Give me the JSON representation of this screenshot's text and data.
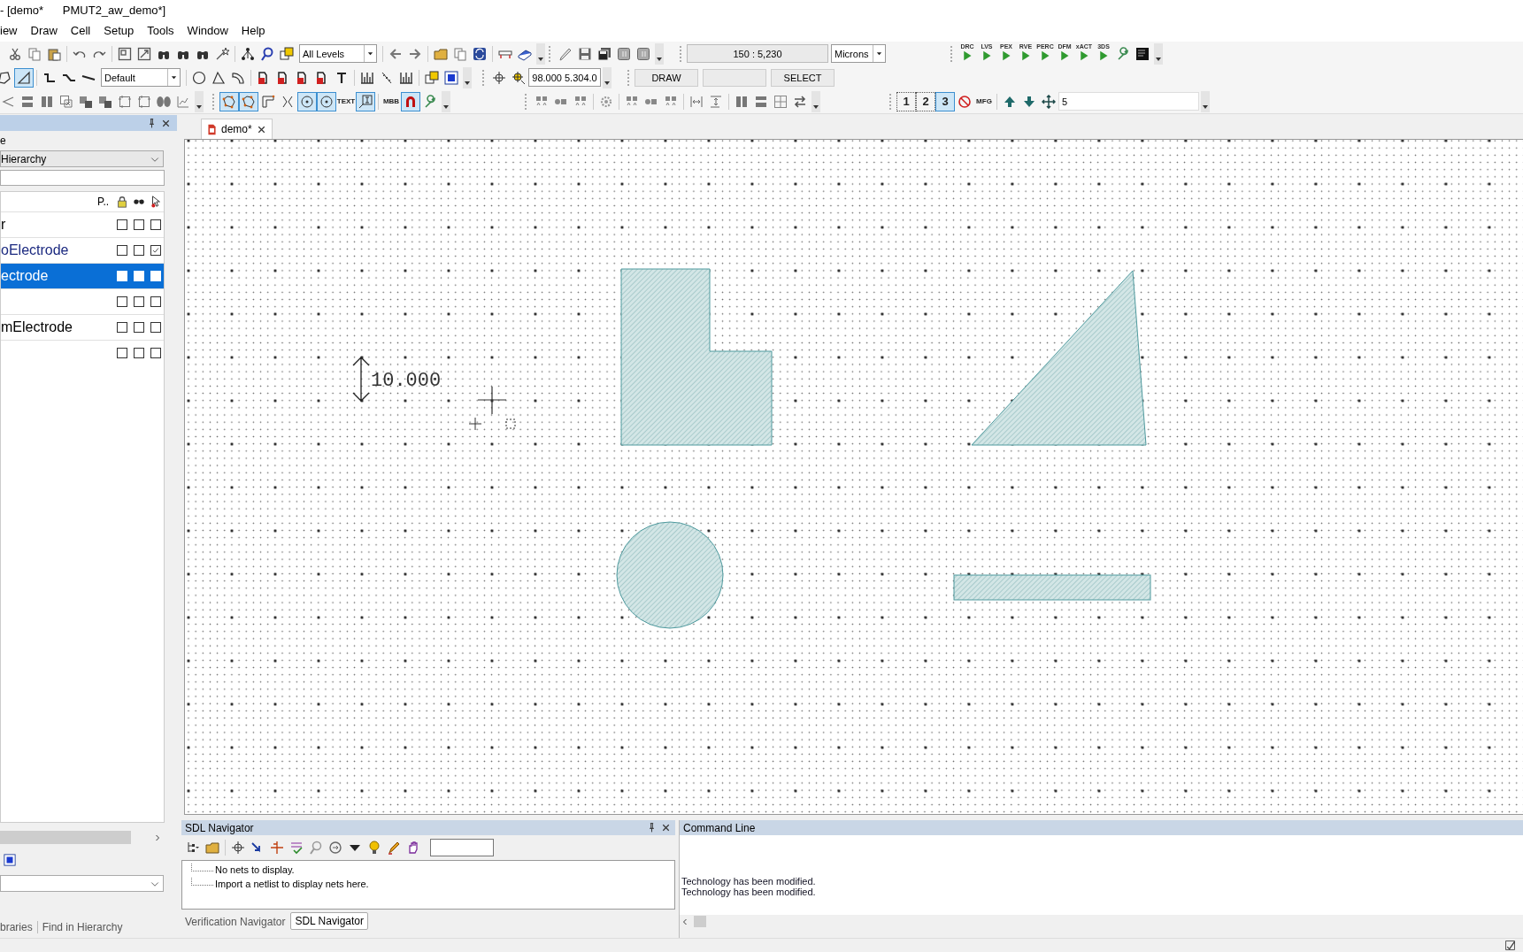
{
  "title_bar": {
    "title": "- [demo*      PMUT2_aw_demo*]"
  },
  "menu": [
    "iew",
    "Draw",
    "Cell",
    "Setup",
    "Tools",
    "Window",
    "Help"
  ],
  "toolbars": [
    [
      {
        "items": [
          {
            "kind": "icon"
          },
          {
            "kind": "icon"
          },
          {
            "kind": "icon"
          },
          {
            "kind": "sep"
          },
          {
            "kind": "icon"
          },
          {
            "kind": "icon"
          },
          {
            "kind": "sep"
          },
          {
            "kind": "icon"
          },
          {
            "kind": "icon"
          },
          {
            "kind": "icon"
          },
          {
            "kind": "icon"
          },
          {
            "kind": "icon"
          },
          {
            "kind": "icon"
          },
          {
            "kind": "sep"
          },
          {
            "kind": "icon"
          },
          {
            "kind": "icon"
          },
          {
            "kind": "icon"
          },
          {
            "kind": "dropdown",
            "value": "All Levels"
          },
          {
            "kind": "sep"
          },
          {
            "kind": "icon"
          },
          {
            "kind": "icon"
          },
          {
            "kind": "sep"
          },
          {
            "kind": "icon"
          },
          {
            "kind": "icon"
          },
          {
            "kind": "icon"
          },
          {
            "kind": "sep"
          },
          {
            "kind": "icon"
          },
          {
            "kind": "icon"
          },
          {
            "kind": "more"
          }
        ]
      },
      {
        "items": [
          {
            "kind": "icon"
          },
          {
            "kind": "icon"
          },
          {
            "kind": "icon"
          },
          {
            "kind": "icon"
          },
          {
            "kind": "icon"
          },
          {
            "kind": "more"
          }
        ]
      },
      {
        "items": [
          {
            "kind": "field",
            "value": "150 : 5,230"
          },
          {
            "kind": "dropdown",
            "value": "Microns"
          }
        ]
      },
      {
        "items": [
          {
            "kind": "run",
            "label": "DRC"
          },
          {
            "kind": "run",
            "label": "LVS"
          },
          {
            "kind": "run",
            "label": "PEX"
          },
          {
            "kind": "run",
            "label": "RVE"
          },
          {
            "kind": "run",
            "label": "PERC"
          },
          {
            "kind": "run",
            "label": "DFM"
          },
          {
            "kind": "run",
            "label": "xACT"
          },
          {
            "kind": "run",
            "label": "3DS"
          },
          {
            "kind": "icon"
          },
          {
            "kind": "icon"
          },
          {
            "kind": "more"
          }
        ]
      }
    ],
    [
      {
        "items": [
          {
            "kind": "icon",
            "pressed": false
          },
          {
            "kind": "icon",
            "pressed": true
          },
          {
            "kind": "sep"
          },
          {
            "kind": "icon",
            "pressed": false
          },
          {
            "kind": "icon",
            "pressed": false
          },
          {
            "kind": "icon",
            "pressed": false
          },
          {
            "kind": "dropdown",
            "value": "Default"
          },
          {
            "kind": "sep"
          },
          {
            "kind": "icon",
            "pressed": false
          },
          {
            "kind": "icon",
            "pressed": false
          },
          {
            "kind": "icon",
            "pressed": false
          },
          {
            "kind": "sep"
          },
          {
            "kind": "icon",
            "pressed": false
          },
          {
            "kind": "icon",
            "pressed": false
          },
          {
            "kind": "icon",
            "pressed": false
          },
          {
            "kind": "icon",
            "pressed": false
          },
          {
            "kind": "icon",
            "pressed": false
          },
          {
            "kind": "sep"
          },
          {
            "kind": "icon",
            "pressed": false
          },
          {
            "kind": "icon",
            "pressed": false
          },
          {
            "kind": "icon",
            "pressed": false
          },
          {
            "kind": "sep"
          },
          {
            "kind": "icon",
            "pressed": false
          },
          {
            "kind": "icon",
            "pressed": false
          },
          {
            "kind": "more"
          }
        ]
      },
      {
        "items": [
          {
            "kind": "icon"
          },
          {
            "kind": "icon"
          },
          {
            "kind": "field",
            "value": "98.000 5.304.0"
          },
          {
            "kind": "more"
          }
        ]
      },
      {
        "items": [
          {
            "kind": "status",
            "label": "DRAW"
          },
          {
            "kind": "status"
          },
          {
            "kind": "status",
            "label": "SELECT"
          }
        ]
      }
    ],
    [
      {
        "items": [
          {
            "kind": "icon"
          },
          {
            "kind": "icon"
          },
          {
            "kind": "icon"
          },
          {
            "kind": "icon"
          },
          {
            "kind": "icon"
          },
          {
            "kind": "icon"
          },
          {
            "kind": "icon"
          },
          {
            "kind": "icon"
          },
          {
            "kind": "icon"
          },
          {
            "kind": "icon"
          },
          {
            "kind": "more"
          }
        ]
      },
      {
        "items": [
          {
            "kind": "icon",
            "pressed": true
          },
          {
            "kind": "icon",
            "pressed": true
          },
          {
            "kind": "icon",
            "pressed": false
          },
          {
            "kind": "icon",
            "pressed": false
          },
          {
            "kind": "icon",
            "pressed": true
          },
          {
            "kind": "icon",
            "pressed": true
          },
          {
            "kind": "icon",
            "pressed": false,
            "label": "TEXT"
          },
          {
            "kind": "icon",
            "pressed": true
          },
          {
            "kind": "sep"
          },
          {
            "kind": "icon",
            "pressed": false,
            "label": "MBB"
          },
          {
            "kind": "icon",
            "pressed": true
          },
          {
            "kind": "icon",
            "pressed": false
          },
          {
            "kind": "more"
          }
        ]
      },
      {
        "items": [
          {
            "kind": "icon"
          },
          {
            "kind": "icon"
          },
          {
            "kind": "icon"
          },
          {
            "kind": "sep"
          },
          {
            "kind": "icon"
          },
          {
            "kind": "sep"
          },
          {
            "kind": "icon"
          },
          {
            "kind": "icon"
          },
          {
            "kind": "icon"
          },
          {
            "kind": "sep"
          },
          {
            "kind": "icon"
          },
          {
            "kind": "icon"
          },
          {
            "kind": "sep"
          },
          {
            "kind": "icon"
          },
          {
            "kind": "icon"
          },
          {
            "kind": "icon"
          },
          {
            "kind": "icon"
          },
          {
            "kind": "more"
          }
        ]
      },
      {
        "items": [
          {
            "kind": "icon",
            "pressed": false,
            "label": "1"
          },
          {
            "kind": "icon",
            "pressed": false,
            "label": "2"
          },
          {
            "kind": "icon",
            "pressed": true,
            "label": "3"
          },
          {
            "kind": "icon",
            "pressed": false
          },
          {
            "kind": "icon",
            "pressed": false,
            "label": "MFG"
          },
          {
            "kind": "sep"
          },
          {
            "kind": "icon",
            "pressed": false
          },
          {
            "kind": "icon",
            "pressed": false
          },
          {
            "kind": "icon",
            "pressed": false
          },
          {
            "kind": "field",
            "value": "5"
          },
          {
            "kind": "more"
          }
        ]
      }
    ]
  ],
  "cells_panel": {
    "label": "e",
    "view": "Hierarchy",
    "columns": [
      "P.."
    ],
    "rows": [
      {
        "name": "r",
        "selected": false,
        "checks": [
          {
            "checked": false
          },
          {
            "checked": false
          },
          {
            "checked": false
          }
        ]
      },
      {
        "name": "oElectrode",
        "color": "#1c2a80",
        "selected": false,
        "checks": [
          {
            "checked": false
          },
          {
            "checked": false
          },
          {
            "checked": true
          }
        ]
      },
      {
        "name": "ectrode",
        "selected": true,
        "checks": [
          {
            "checked": false
          },
          {
            "checked": false
          },
          {
            "checked": false
          }
        ]
      },
      {
        "selected": false,
        "checks": [
          {
            "checked": false
          },
          {
            "checked": false
          },
          {
            "checked": false
          }
        ]
      },
      {
        "name": "mElectrode",
        "color": "#000000",
        "selected": false,
        "checks": [
          {
            "checked": false
          },
          {
            "checked": false
          },
          {
            "checked": false
          }
        ]
      },
      {
        "selected": false,
        "checks": [
          {
            "checked": false
          },
          {
            "checked": false
          },
          {
            "checked": false
          }
        ]
      }
    ],
    "tabs": [
      {
        "label": "braries",
        "selected": false
      },
      {
        "label": "Find in Hierarchy",
        "selected": false
      }
    ]
  },
  "document_tabs": [
    {
      "label": "demo*",
      "selected": true
    }
  ],
  "canvas": {
    "ruler_label": "10.000"
  },
  "sdl_navigator": {
    "title": "SDL Navigator",
    "messages": [
      "No nets to display.",
      "Import a netlist to display nets here."
    ]
  },
  "bottom_tabs": [
    {
      "label": "Verification Navigator",
      "selected": false
    },
    {
      "label": "SDL Navigator",
      "selected": true
    }
  ],
  "command_line": {
    "title": "Command Line",
    "lines": [
      "Technology has been modified.",
      "Technology has been modified."
    ]
  }
}
